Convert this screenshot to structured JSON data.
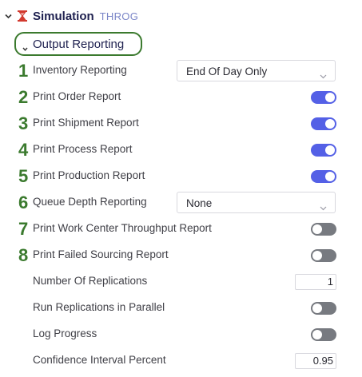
{
  "header": {
    "title": "Simulation",
    "subtitle": "THROG",
    "icon": "simulation-icon"
  },
  "section": {
    "title": "Output Reporting"
  },
  "rows": [
    {
      "num": "1",
      "label": "Inventory Reporting",
      "control": "select",
      "value": "End Of Day Only"
    },
    {
      "num": "2",
      "label": "Print Order Report",
      "control": "toggle",
      "on": true
    },
    {
      "num": "3",
      "label": "Print Shipment Report",
      "control": "toggle",
      "on": true
    },
    {
      "num": "4",
      "label": "Print Process Report",
      "control": "toggle",
      "on": true
    },
    {
      "num": "5",
      "label": "Print Production Report",
      "control": "toggle",
      "on": true
    },
    {
      "num": "6",
      "label": "Queue Depth Reporting",
      "control": "select",
      "value": "None"
    },
    {
      "num": "7",
      "label": "Print Work Center Throughput Report",
      "control": "toggle",
      "on": false
    },
    {
      "num": "8",
      "label": "Print Failed Sourcing Report",
      "control": "toggle",
      "on": false
    },
    {
      "num": "",
      "label": "Number Of Replications",
      "control": "number",
      "value": "1"
    },
    {
      "num": "",
      "label": "Run Replications in Parallel",
      "control": "toggle",
      "on": false
    },
    {
      "num": "",
      "label": "Log Progress",
      "control": "toggle",
      "on": false
    },
    {
      "num": "",
      "label": "Confidence Interval Percent",
      "control": "number",
      "value": "0.95"
    }
  ],
  "colors": {
    "annotation_green": "#3b7a2e",
    "toggle_on": "#5460e6",
    "toggle_off": "#777a80",
    "title_navy": "#1f2150"
  }
}
